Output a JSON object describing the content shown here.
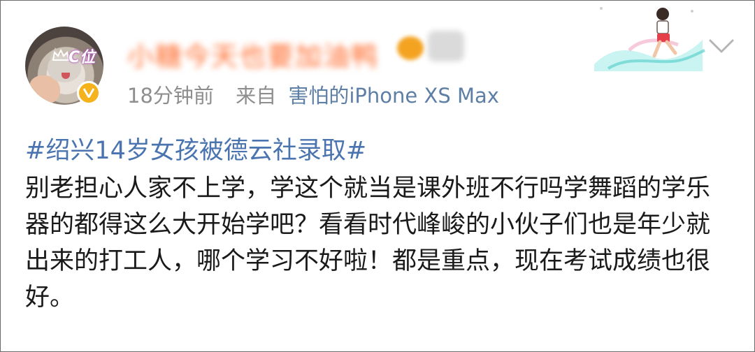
{
  "post": {
    "avatar_badge": "C位",
    "username": "小糖今天也要加油鸭",
    "meta": {
      "time": "18分钟前",
      "from_label": "来自",
      "device": "害怕的iPhone XS Max"
    },
    "hashtag": "#绍兴14岁女孩被德云社录取#",
    "body": "别老担心人家不上学，学这个就当是课外班不行吗学舞蹈的学乐器的都得这么大开始学吧？看看时代峰峻的小伙子们也是年少就出来的打工人，哪个学习不好啦！都是重点，现在考试成绩也很好。"
  },
  "icons": {
    "verified": "verified-badge-icon",
    "more": "chevron-down-icon"
  },
  "colors": {
    "hashtag": "#4a74b0",
    "device_link": "#5d7fa6",
    "meta_text": "#8e8e8e",
    "verified": "#f5b21a"
  }
}
